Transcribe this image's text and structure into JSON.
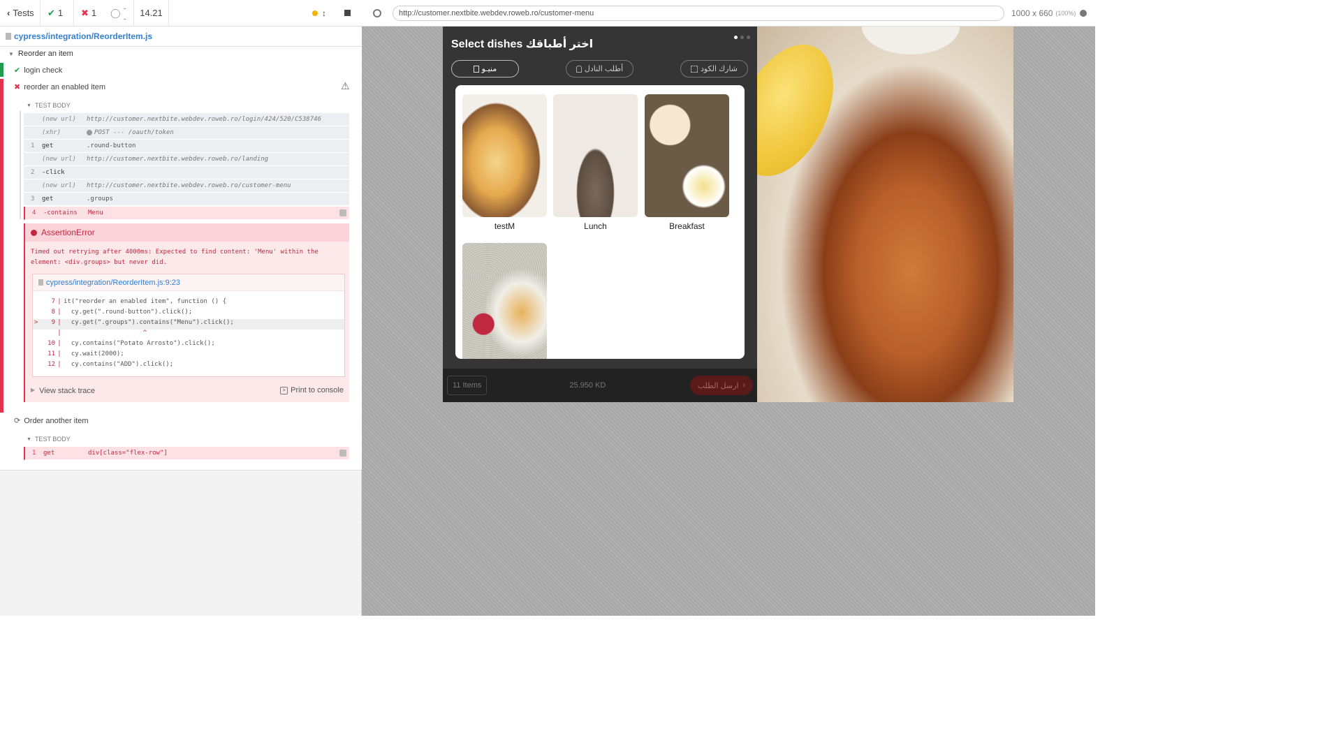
{
  "runner": {
    "tests_label": "Tests",
    "passed": "1",
    "failed": "1",
    "pending": "--",
    "duration": "14.21",
    "spec_file": "cypress/integration/ReorderItem.js"
  },
  "suite": {
    "title": "Reorder an item",
    "tests": [
      {
        "title": "login check",
        "state": "passed"
      },
      {
        "title": "reorder an enabled item",
        "state": "failed"
      },
      {
        "title": "Order another item",
        "state": "pending"
      }
    ],
    "test_body_label": "TEST BODY",
    "commands": [
      {
        "num": "",
        "name": "(new url)",
        "msg": "http://customer.nextbite.webdev.roweb.ro/login/424/520/C538746"
      },
      {
        "num": "",
        "name": "(xhr)",
        "msg": "POST --- /oauth/token"
      },
      {
        "num": "1",
        "name": "get",
        "msg": ".round-button"
      },
      {
        "num": "",
        "name": "(new url)",
        "msg": "http://customer.nextbite.webdev.roweb.ro/landing"
      },
      {
        "num": "2",
        "name": "-click",
        "msg": ""
      },
      {
        "num": "",
        "name": "(new url)",
        "msg": "http://customer.nextbite.webdev.roweb.ro/customer-menu"
      },
      {
        "num": "3",
        "name": "get",
        "msg": ".groups"
      },
      {
        "num": "4",
        "name": "-contains",
        "msg": "Menu"
      }
    ],
    "error": {
      "title": "AssertionError",
      "message": "Timed out retrying after 4000ms: Expected to find content: 'Menu' within the element: <div.groups> but never did.",
      "file_link": "cypress/integration/ReorderItem.js:9:23",
      "code": [
        {
          "ln": "7",
          "text": "it(\"reorder an enabled item\", function () {"
        },
        {
          "ln": "8",
          "text": "  cy.get(\".round-button\").click();"
        },
        {
          "ln": "9",
          "text": "  cy.get(\".groups\").contains(\"Menu\").click();"
        },
        {
          "ln": "",
          "text": "                     ^"
        },
        {
          "ln": "10",
          "text": "  cy.contains(\"Potato Arrosto\").click();"
        },
        {
          "ln": "11",
          "text": "  cy.wait(2000);"
        },
        {
          "ln": "12",
          "text": "  cy.contains(\"ADD\").click();"
        }
      ],
      "stack_trace_label": "View stack trace",
      "print_label": "Print to console"
    },
    "second_body_cmd": {
      "num": "1",
      "name": "get",
      "msg": "div[class=\"flex-row\"]"
    }
  },
  "browser": {
    "url": "http://customer.nextbite.webdev.roweb.ro/customer-menu",
    "viewport": "1000 x 660",
    "zoom": "(100%)"
  },
  "app": {
    "heading": "Select dishes اختر أطباقك",
    "buttons": {
      "menu": "منيـو",
      "waiter": "أطلب النادل",
      "share": "شارك الكود"
    },
    "categories": [
      {
        "label": "testM"
      },
      {
        "label": "Lunch"
      },
      {
        "label": "Breakfast"
      },
      {
        "label": ""
      }
    ],
    "footer": {
      "items": "11 Items",
      "total": "25.950 KD",
      "send": "ارسل الطلب"
    }
  }
}
